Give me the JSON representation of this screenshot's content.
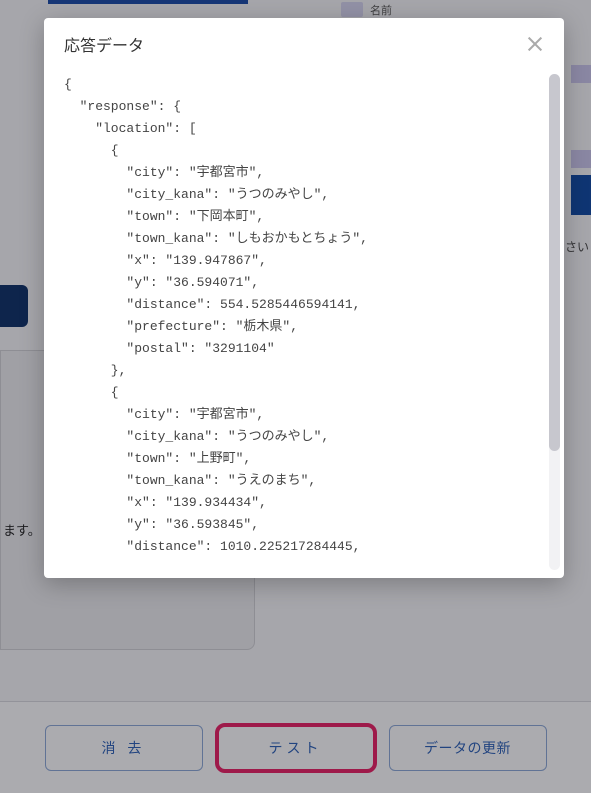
{
  "background": {
    "small_label": "名前",
    "right_text": "さい",
    "left_text": "ます。"
  },
  "buttons": {
    "clear": "消 去",
    "test": "テスト",
    "update": "データの更新"
  },
  "modal": {
    "title": "応答データ",
    "code": "{\n  \"response\": {\n    \"location\": [\n      {\n        \"city\": \"宇都宮市\",\n        \"city_kana\": \"うつのみやし\",\n        \"town\": \"下岡本町\",\n        \"town_kana\": \"しもおかもとちょう\",\n        \"x\": \"139.947867\",\n        \"y\": \"36.594071\",\n        \"distance\": 554.5285446594141,\n        \"prefecture\": \"栃木県\",\n        \"postal\": \"3291104\"\n      },\n      {\n        \"city\": \"宇都宮市\",\n        \"city_kana\": \"うつのみやし\",\n        \"town\": \"上野町\",\n        \"town_kana\": \"うえのまち\",\n        \"x\": \"139.934434\",\n        \"y\": \"36.593845\",\n        \"distance\": 1010.225217284445,"
  }
}
